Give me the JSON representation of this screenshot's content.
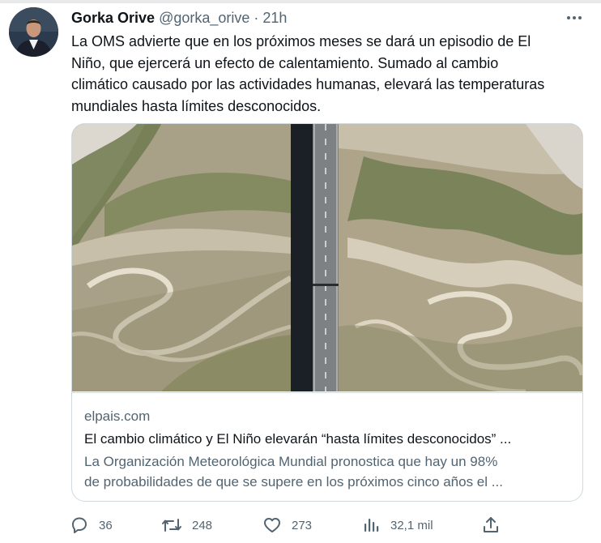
{
  "author": {
    "name": "Gorka Orive",
    "handle": "@gorka_orive",
    "separator": "·",
    "time": "21h"
  },
  "tweet_lines": [
    "La OMS advierte que en los próximos meses se dará un episodio de El",
    "Niño, que ejercerá un efecto de calentamiento. Sumado al cambio",
    "climático causado por las actividades humanas, elevará las temperaturas",
    "mundiales hasta límites desconocidos."
  ],
  "card": {
    "domain": "elpais.com",
    "title": "El cambio climático y El Niño elevarán “hasta límites desconocidos” ...",
    "desc_lines": [
      "La Organización Meteorológica Mundial pronostica que hay un 98%",
      "de probabilidades de que se supere en los próximos cinco años el ..."
    ]
  },
  "actions": {
    "replies": "36",
    "retweets": "248",
    "likes": "273",
    "views": "32,1 mil"
  },
  "icons": {
    "more": "more-icon",
    "reply": "reply-icon",
    "retweet": "retweet-icon",
    "like": "heart-icon",
    "views": "views-icon",
    "share": "share-icon"
  },
  "colors": {
    "text": "#0f1419",
    "secondary": "#536471",
    "border": "#cfd9de"
  }
}
